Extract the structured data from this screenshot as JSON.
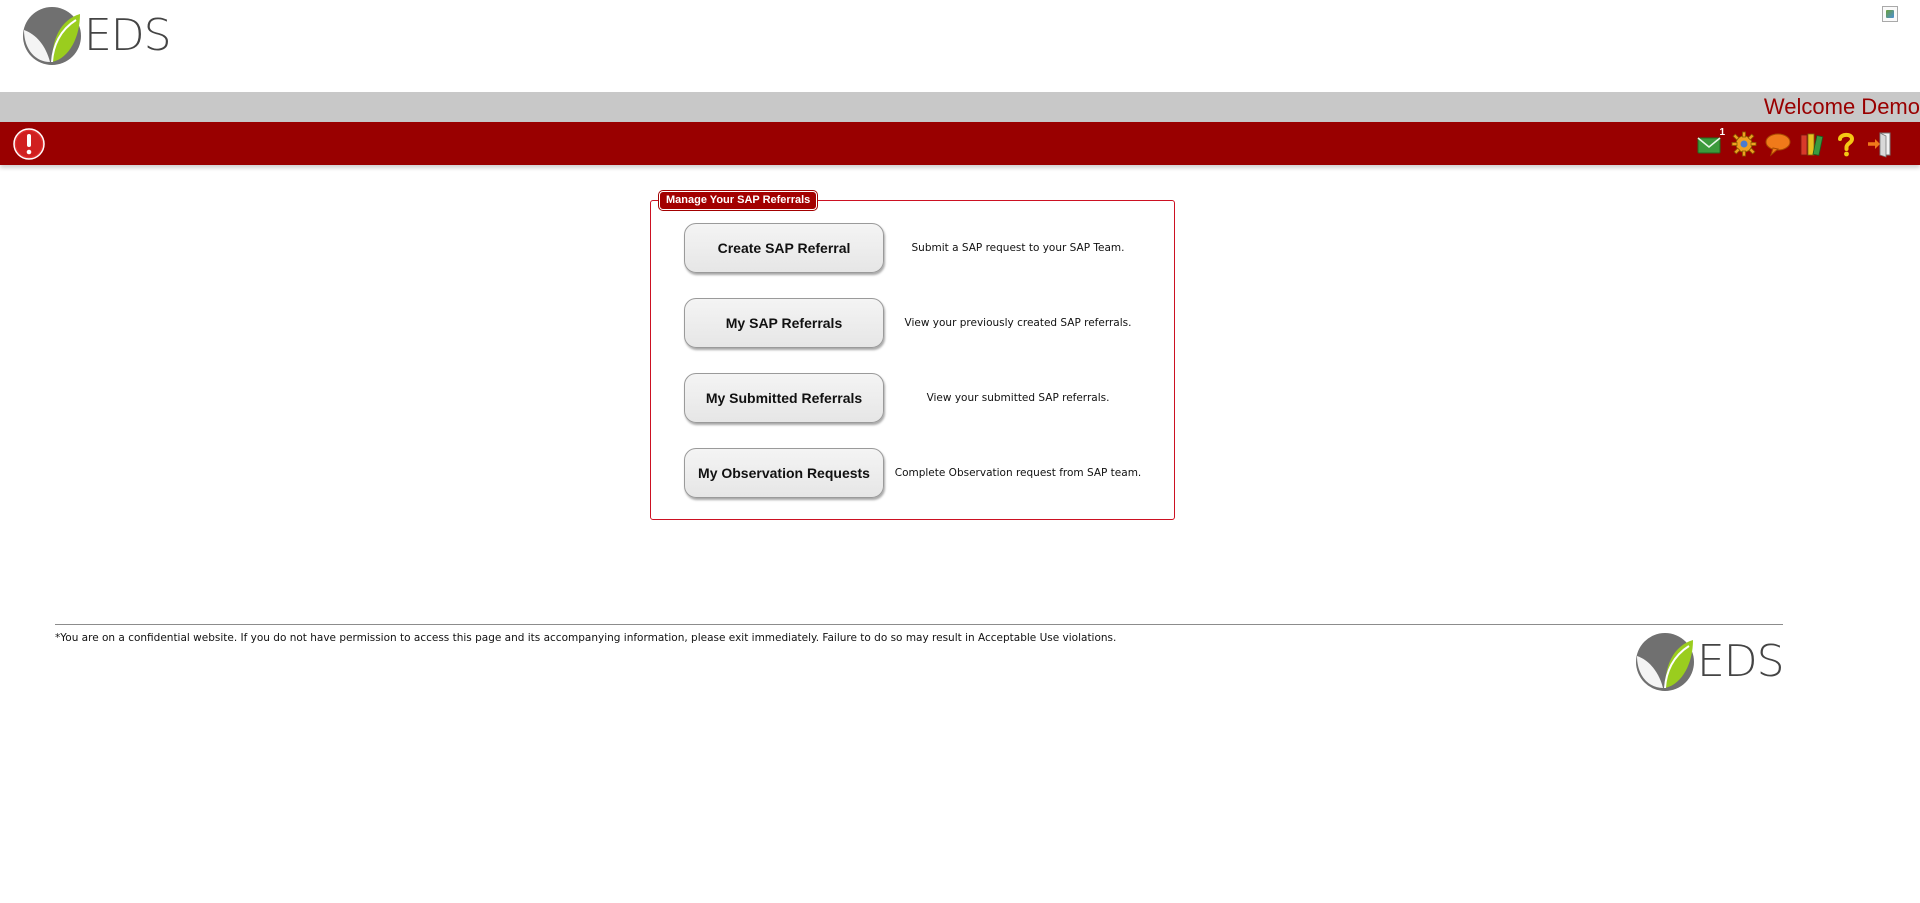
{
  "header": {
    "logo_text": "EDS",
    "broken_image_icon": "broken-image-icon"
  },
  "welcome_bar": {
    "text": "Welcome Demo"
  },
  "toolbar": {
    "alert_icon": "exclamation-alert-icon",
    "icons": [
      {
        "name": "mail-icon",
        "count": "1"
      },
      {
        "name": "gear-icon"
      },
      {
        "name": "chat-bubble-icon"
      },
      {
        "name": "books-icon"
      },
      {
        "name": "help-icon"
      },
      {
        "name": "logout-icon"
      }
    ]
  },
  "panel": {
    "legend": "Manage Your SAP Referrals",
    "actions": [
      {
        "label": "Create SAP Referral",
        "description": "Submit a SAP request to your SAP Team."
      },
      {
        "label": "My SAP Referrals",
        "description": "View your previously created SAP referrals."
      },
      {
        "label": "My Submitted Referrals",
        "description": "View your submitted SAP referrals."
      },
      {
        "label": "My Observation Requests",
        "description": "Complete Observation request from SAP team."
      }
    ]
  },
  "footer": {
    "disclaimer": "*You are on a confidential website. If you do not have permission to access this page and its accompanying information, please exit immediately. Failure to do so may result in Acceptable Use violations.",
    "logo_text": "EDS"
  },
  "colors": {
    "brand_red": "#990000",
    "welcome_bar_gray": "#c8c8c8",
    "logo_green": "#9acd1e",
    "logo_gray": "#707070"
  }
}
